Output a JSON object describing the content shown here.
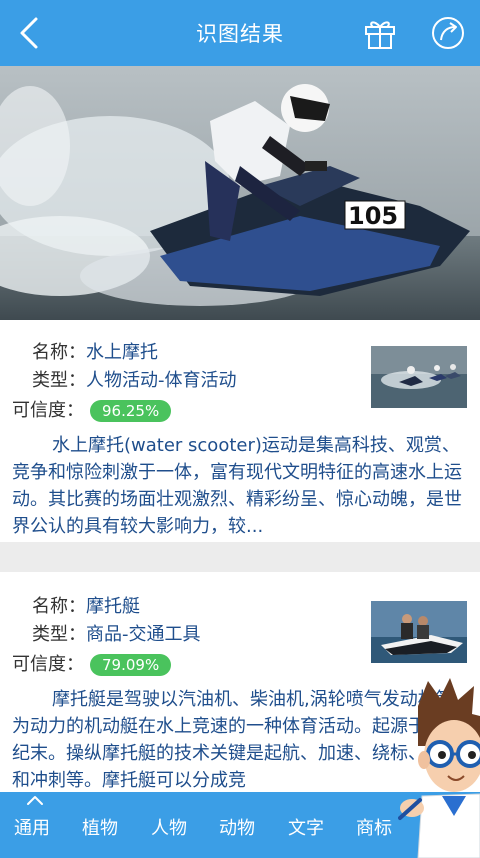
{
  "header": {
    "title": "识图结果",
    "back_icon": "back-arrow-icon",
    "gift_icon": "gift-icon",
    "share_icon": "share-icon"
  },
  "results": [
    {
      "name_label": "名称：",
      "name": "水上摩托",
      "type_label": "类型：",
      "type": "人物活动-体育活动",
      "confidence_label": "可信度：",
      "confidence": "96.25%",
      "description": "水上摩托(water scooter)运动是集高科技、观赏、竞争和惊险刺激于一体，富有现代文明特征的高速水上运动。其比赛的场面壮观激烈、精彩纷呈、惊心动魄，是世界公认的具有较大影响力，较..."
    },
    {
      "name_label": "名称：",
      "name": "摩托艇",
      "type_label": "类型：",
      "type": "商品-交通工具",
      "confidence_label": "可信度：",
      "confidence": "79.09%",
      "description": "摩托艇是驾驶以汽油机、柴油机,涡轮喷气发动机等为动力的机动艇在水上竞速的一种体育活动。起源于19世纪末。操纵摩托艇的技术关键是起航、加速、绕标、超越和冲刺等。摩托艇可以分成竞"
    }
  ],
  "bottom_nav": {
    "items": [
      "通用",
      "植物",
      "人物",
      "动物",
      "文字",
      "商标",
      "车"
    ]
  },
  "colors": {
    "primary": "#3b9ee6",
    "confidence_badge": "#4ac35d",
    "value_text": "#1f4e8c"
  }
}
